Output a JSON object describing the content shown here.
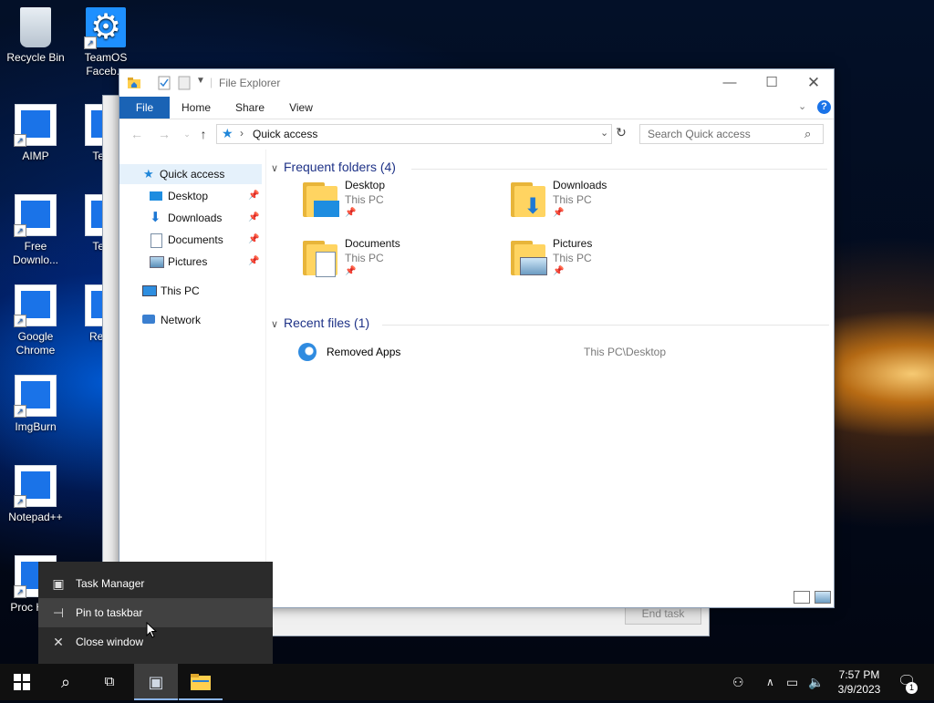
{
  "desktop": {
    "icons": [
      {
        "label": "Recycle Bin"
      },
      {
        "label": "TeamOS Faceb..."
      },
      {
        "label": "AIMP"
      },
      {
        "label": "Team"
      },
      {
        "label": "Free Downlo..."
      },
      {
        "label": "Team"
      },
      {
        "label": "Google Chrome"
      },
      {
        "label": "Rem A"
      },
      {
        "label": "ImgBurn"
      },
      {
        "label": "Notepad++"
      },
      {
        "label": "Proc Hack"
      }
    ]
  },
  "task_manager": {
    "end_task_label": "End task"
  },
  "explorer": {
    "title": "File Explorer",
    "ribbon_tabs": [
      "File",
      "Home",
      "Share",
      "View"
    ],
    "address": "Quick access",
    "search_placeholder": "Search Quick access",
    "nav": [
      {
        "label": "Quick access"
      },
      {
        "label": "Desktop"
      },
      {
        "label": "Downloads"
      },
      {
        "label": "Documents"
      },
      {
        "label": "Pictures"
      },
      {
        "label": "This PC"
      },
      {
        "label": "Network"
      }
    ],
    "frequent_header": "Frequent folders (4)",
    "folders": [
      {
        "name": "Desktop",
        "location": "This PC"
      },
      {
        "name": "Downloads",
        "location": "This PC"
      },
      {
        "name": "Documents",
        "location": "This PC"
      },
      {
        "name": "Pictures",
        "location": "This PC"
      }
    ],
    "recent_header": "Recent files (1)",
    "recent": [
      {
        "name": "Removed Apps",
        "path": "This PC\\Desktop"
      }
    ]
  },
  "context_menu": {
    "items": [
      {
        "label": "Task Manager"
      },
      {
        "label": "Pin to taskbar"
      },
      {
        "label": "Close window"
      }
    ]
  },
  "taskbar": {
    "time": "7:57 PM",
    "date": "3/9/2023",
    "notification_count": "1"
  },
  "colors": {
    "accent": "#1a63b5",
    "header_text": "#1e3287",
    "menu_bg": "#2b2b2b",
    "taskbar_bg": "#101010"
  }
}
